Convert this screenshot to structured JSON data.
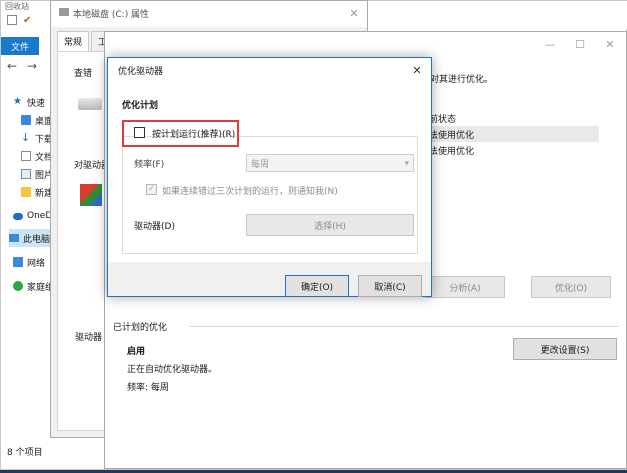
{
  "explorer": {
    "title_fragment": "回收站",
    "ribbon_file_tab": "文件",
    "sidebar": [
      {
        "icon": "star-icon",
        "label": "快速"
      },
      {
        "icon": "desktop-icon",
        "label": "桌面"
      },
      {
        "icon": "download-icon",
        "label": "下载"
      },
      {
        "icon": "document-icon",
        "label": "文档"
      },
      {
        "icon": "picture-icon",
        "label": "图片"
      },
      {
        "icon": "folder-icon",
        "label": "新建"
      },
      {
        "icon": "cloud-icon",
        "label": "OneD"
      },
      {
        "icon": "computer-icon",
        "label": "此电脑"
      },
      {
        "icon": "network-icon",
        "label": "网络"
      },
      {
        "icon": "homegroup-icon",
        "label": "家庭组"
      }
    ],
    "status_count": "8 个项目"
  },
  "properties": {
    "title": "本地磁盘 (C:) 属性",
    "tabs": [
      "常规",
      "工"
    ],
    "section_label": "查错",
    "section2_label": "对驱动器"
  },
  "optimize": {
    "title": "优化驱动器",
    "desc_fragment": "对其进行优化。",
    "status_header": "前状态",
    "status_rows": [
      "法使用优化",
      "法使用优化"
    ],
    "analyze_button": "分析(A)",
    "optimize_button": "优化(O)",
    "scheduled_heading": "已计划的优化",
    "scheduled_state": "启用",
    "scheduled_desc": "正在自动优化驱动器。",
    "frequency_text": "频率: 每周",
    "change_settings_button": "更改设置(S)",
    "left_cut_label": "驱动器"
  },
  "dialog": {
    "title": "优化驱动器",
    "section": "优化计划",
    "run_on_schedule_label": "按计划运行(推荐)(R)",
    "run_on_schedule_checked": false,
    "frequency_label": "频率(F)",
    "frequency_value": "每周",
    "notify_label": "如果连续错过三次计划的运行，则通知我(N)",
    "notify_checked": true,
    "drives_label": "驱动器(D)",
    "choose_button": "选择(H)",
    "ok_button": "确定(O)",
    "cancel_button": "取消(C)"
  },
  "colors": {
    "accent": "#1979ca",
    "highlight": "#e23b3b",
    "dialog_border": "#1c73c6"
  }
}
